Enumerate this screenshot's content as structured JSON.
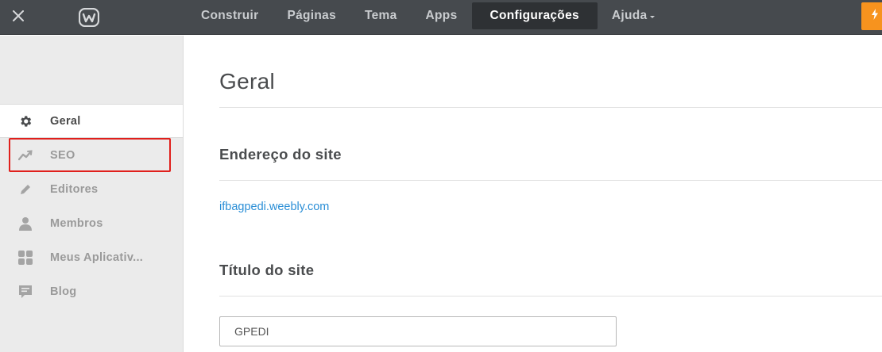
{
  "topbar": {
    "nav": [
      {
        "label": "Construir",
        "active": false
      },
      {
        "label": "Páginas",
        "active": false
      },
      {
        "label": "Tema",
        "active": false
      },
      {
        "label": "Apps",
        "active": false
      },
      {
        "label": "Configurações",
        "active": true
      },
      {
        "label": "Ajuda",
        "active": false,
        "dropdown": true
      }
    ],
    "icons": {
      "close": "close-icon",
      "logo": "weebly-logo-icon",
      "upgrade": "lightning-icon"
    },
    "colors": {
      "bar": "#464a4e",
      "active_tab": "#2e3134",
      "upgrade_button": "#f7931e"
    }
  },
  "sidebar": {
    "items": [
      {
        "label": "Geral",
        "icon": "gear-icon",
        "active": true
      },
      {
        "label": "SEO",
        "icon": "trend-line-icon",
        "active": false
      },
      {
        "label": "Editores",
        "icon": "pencil-icon",
        "active": false,
        "highlighted": true
      },
      {
        "label": "Membros",
        "icon": "person-icon",
        "active": false
      },
      {
        "label": "Meus Aplicativ...",
        "icon": "grid-icon",
        "active": false
      },
      {
        "label": "Blog",
        "icon": "speech-bubble-icon",
        "active": false
      }
    ],
    "colors": {
      "background": "#ebebeb",
      "highlight_border": "#e0201c"
    }
  },
  "main": {
    "page_title": "Geral",
    "site_address": {
      "heading": "Endereço do site",
      "url": "ifbagpedi.weebly.com"
    },
    "site_title": {
      "heading": "Título do site",
      "value": "GPEDI"
    },
    "colors": {
      "link": "#2a8ed6"
    }
  }
}
